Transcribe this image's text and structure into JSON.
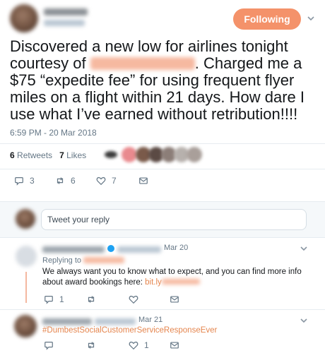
{
  "main_tweet": {
    "follow_label": "Following",
    "text_before": "Discovered a new low for airlines tonight courtesy of ",
    "text_after": ". Charged me a $75 “expedite fee” for using frequent flyer miles on a flight within 21 days. How dare I use what I’ve earned without retribution!!!!",
    "timestamp": "6:59 PM - 20 Mar 2018",
    "retweets_count": "6",
    "retweets_label": "Retweets",
    "likes_count": "7",
    "likes_label": "Likes",
    "reply_count": "3",
    "retweet_count": "6",
    "like_count": "7"
  },
  "composer": {
    "placeholder": "Tweet your reply"
  },
  "replies": [
    {
      "date": "Mar 20",
      "replying_label": "Replying to",
      "text": "We always want you to know what to expect, and you can find more info about award bookings here: ",
      "link_text": "bit.ly",
      "reply_count": "1"
    },
    {
      "date": "Mar 21",
      "hashtag": "#DumbestSocialCustomerServiceResponseEver",
      "like_count": "1"
    }
  ],
  "colors": {
    "accent": "#f4926a",
    "link": "#e5864f",
    "muted": "#657786"
  }
}
